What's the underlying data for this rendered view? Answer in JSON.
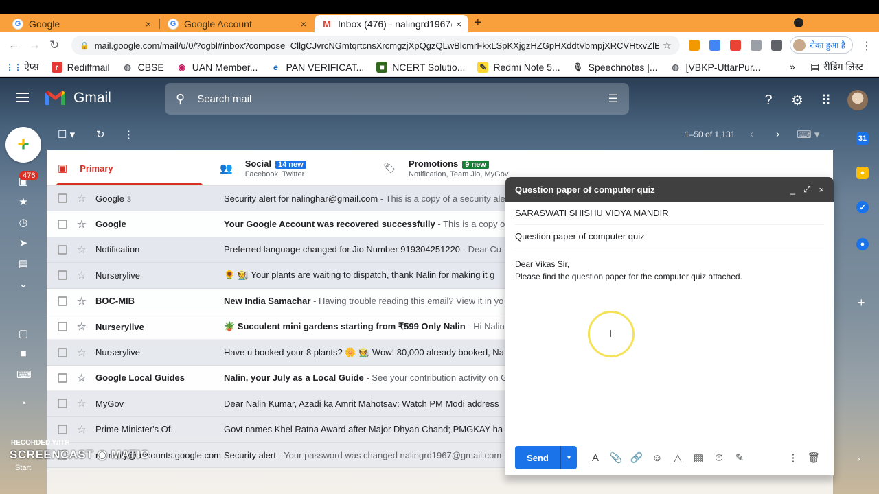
{
  "browser": {
    "tabs": [
      {
        "title": "Google",
        "close": "×"
      },
      {
        "title": "Google Account",
        "close": "×"
      },
      {
        "title": "Inbox (476) - nalingrd1967@g",
        "close": "×"
      }
    ],
    "new_tab": "+",
    "url": "mail.google.com/mail/u/0/?ogbl#inbox?compose=CllgCJvrcNGmtqrtcnsXrcmgzjXpQgzQLwBlcmrFkxLSpKXjgzHZGpHXddtVbmpjXRCVHtxvZlB",
    "paused_label": "रोका हुआ है",
    "bookmarks": [
      {
        "label": "ऐप्स",
        "icon": "apps-icon"
      },
      {
        "label": "Rediffmail",
        "icon": "rediff-icon"
      },
      {
        "label": "CBSE",
        "icon": "globe-icon"
      },
      {
        "label": "UAN Member...",
        "icon": "uan-icon"
      },
      {
        "label": "PAN VERIFICAT...",
        "icon": "ie-icon"
      },
      {
        "label": "NCERT Solutio...",
        "icon": "ncert-icon"
      },
      {
        "label": "Redmi Note 5...",
        "icon": "redmi-icon"
      },
      {
        "label": "Speechnotes |...",
        "icon": "mic-icon"
      },
      {
        "label": "[VBKP-UttarPur...",
        "icon": "globe-icon"
      }
    ],
    "bookmarks_more": "»",
    "reading_list": "रीडिंग लिस्ट"
  },
  "gmail": {
    "logo_text": "Gmail",
    "search_placeholder": "Search mail",
    "unread_badge": "476",
    "pagination": "1–50 of 1,131",
    "tabs": [
      {
        "name": "Primary",
        "sub": "",
        "badge": ""
      },
      {
        "name": "Social",
        "sub": "Facebook, Twitter",
        "badge": "14 new",
        "badge_color": "#1a73e8"
      },
      {
        "name": "Promotions",
        "sub": "Notification, Team Jio, MyGov",
        "badge": "9 new",
        "badge_color": "#188038"
      }
    ],
    "emails": [
      {
        "sender": "Google",
        "count": "3",
        "subject": "Security alert for nalinghar@gmail.com",
        "snippet": " - This is a copy of a security alert",
        "unread": false
      },
      {
        "sender": "Google",
        "count": "",
        "subject": "Your Google Account was recovered successfully",
        "snippet": " - This is a copy of",
        "unread": true
      },
      {
        "sender": "Notification",
        "count": "",
        "subject": "Preferred language changed for Jio Number 919304251220",
        "snippet": " - Dear Cu",
        "unread": false
      },
      {
        "sender": "Nurserylive",
        "count": "",
        "subject": "🌻 🧑‍🌾 Your plants are waiting to dispatch, thank Nalin for making it g",
        "snippet": "",
        "unread": false
      },
      {
        "sender": "BOC-MIB",
        "count": "",
        "subject": "New India Samachar",
        "snippet": " - Having trouble reading this email? View it in yo",
        "unread": true
      },
      {
        "sender": "Nurserylive",
        "count": "",
        "subject": "🪴 Succulent mini gardens starting from ₹599 Only Nalin",
        "snippet": " - Hi Nalin, ",
        "unread": true
      },
      {
        "sender": "Nurserylive",
        "count": "",
        "subject": "Have u booked your 8 plants? 🌼 🧑‍🌾 Wow! 80,000 already booked, Na",
        "snippet": "",
        "unread": false
      },
      {
        "sender": "Google Local Guides",
        "count": "",
        "subject": "Nalin, your July as a Local Guide",
        "snippet": " - See your contribution activity on G",
        "unread": true
      },
      {
        "sender": "MyGov",
        "count": "",
        "subject": "Dear Nalin Kumar, Azadi ka Amrit Mahotsav: Watch PM Modi address",
        "snippet": "",
        "unread": false
      },
      {
        "sender": "Prime Minister's Of.",
        "count": "",
        "subject": "Govt names Khel Ratna Award after Major Dhyan Chand; PMGKAY ha",
        "snippet": "",
        "unread": false
      },
      {
        "sender": "no-reply@accounts.google.com",
        "count": "",
        "subject": "Security alert",
        "snippet": " - Your password was changed nalingrd1967@gmail.com",
        "unread": false
      }
    ],
    "watermark": {
      "recorded": "RECORDED WITH",
      "brand": "SCREENCAST ◉ MATIC",
      "start": "Start"
    }
  },
  "compose": {
    "title": "Question paper of computer quiz",
    "to": "SARASWATI SHISHU VIDYA MANDIR",
    "subject": "Question paper of computer quiz",
    "body_line1": "Dear Vikas Sir,",
    "body_line2": "Please find the question paper for the computer quiz attached.",
    "send_label": "Send",
    "controls": {
      "minimize": "_",
      "fullscreen": "⤢",
      "close": "×"
    }
  }
}
